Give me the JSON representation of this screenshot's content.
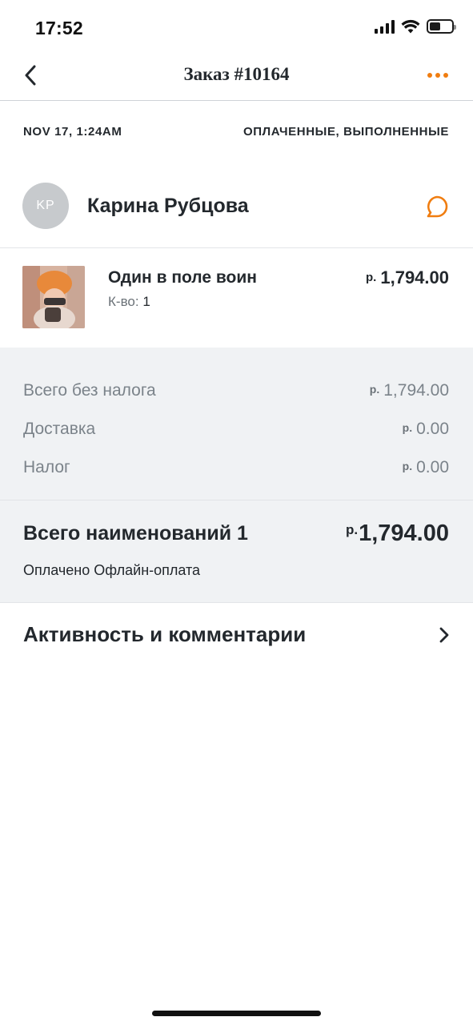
{
  "status_bar": {
    "time": "17:52",
    "battery_level": 0.5
  },
  "nav": {
    "title": "Заказ #10164",
    "accent_color": "#f07d10"
  },
  "order": {
    "date": "NOV 17, 1:24AM",
    "status": "ОПЛАЧЕННЫЕ, ВЫПОЛНЕННЫЕ"
  },
  "customer": {
    "initials": "KP",
    "name": "Карина Рубцова"
  },
  "product": {
    "name": "Один в поле воин",
    "qty_label": "К-во:",
    "qty_value": "1",
    "currency": "р.",
    "price": "1,794.00"
  },
  "summary": {
    "lines": [
      {
        "label": "Всего без налога",
        "currency": "р.",
        "amount": "1,794.00"
      },
      {
        "label": "Доставка",
        "currency": "р.",
        "amount": "0.00"
      },
      {
        "label": "Налог",
        "currency": "р.",
        "amount": "0.00"
      }
    ],
    "total_label": "Всего наименований 1",
    "total_currency": "р.",
    "total_amount": "1,794.00",
    "payment_note": "Оплачено Офлайн-оплата"
  },
  "activity": {
    "label": "Активность и комментарии"
  }
}
